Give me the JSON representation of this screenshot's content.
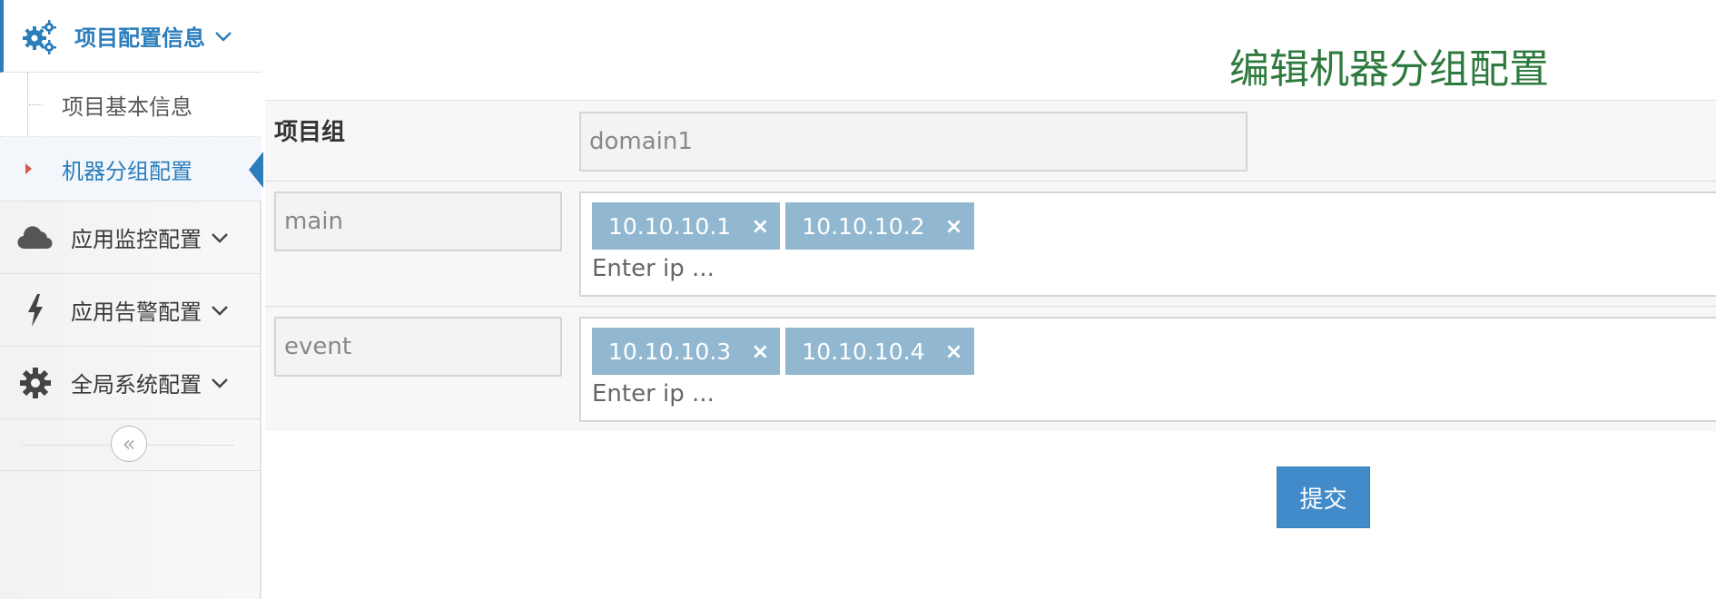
{
  "sidebar": {
    "menus": [
      {
        "label": "项目配置信息",
        "icon": "cogs-icon"
      },
      {
        "label": "应用监控配置",
        "icon": "cloud-icon"
      },
      {
        "label": "应用告警配置",
        "icon": "bolt-icon"
      },
      {
        "label": "全局系统配置",
        "icon": "gear-icon"
      }
    ],
    "submenu": [
      {
        "label": "项目基本信息"
      },
      {
        "label": "机器分组配置"
      }
    ],
    "collapse_glyph": "«"
  },
  "main": {
    "title": "编辑机器分组配置",
    "project_group": {
      "label": "项目组",
      "value": "domain1"
    },
    "groups": [
      {
        "name": "main",
        "tags": [
          "10.10.10.1",
          "10.10.10.2"
        ],
        "input_placeholder": "Enter ip ..."
      },
      {
        "name": "event",
        "tags": [
          "10.10.10.3",
          "10.10.10.4"
        ],
        "input_placeholder": "Enter ip ..."
      }
    ],
    "tag_remove_glyph": "×",
    "submit_label": "提交"
  },
  "colors": {
    "accent": "#2b7dbc",
    "title": "#2e7a3e",
    "tag": "#91b8d0",
    "button": "#428bca",
    "caret": "#d15b47"
  }
}
